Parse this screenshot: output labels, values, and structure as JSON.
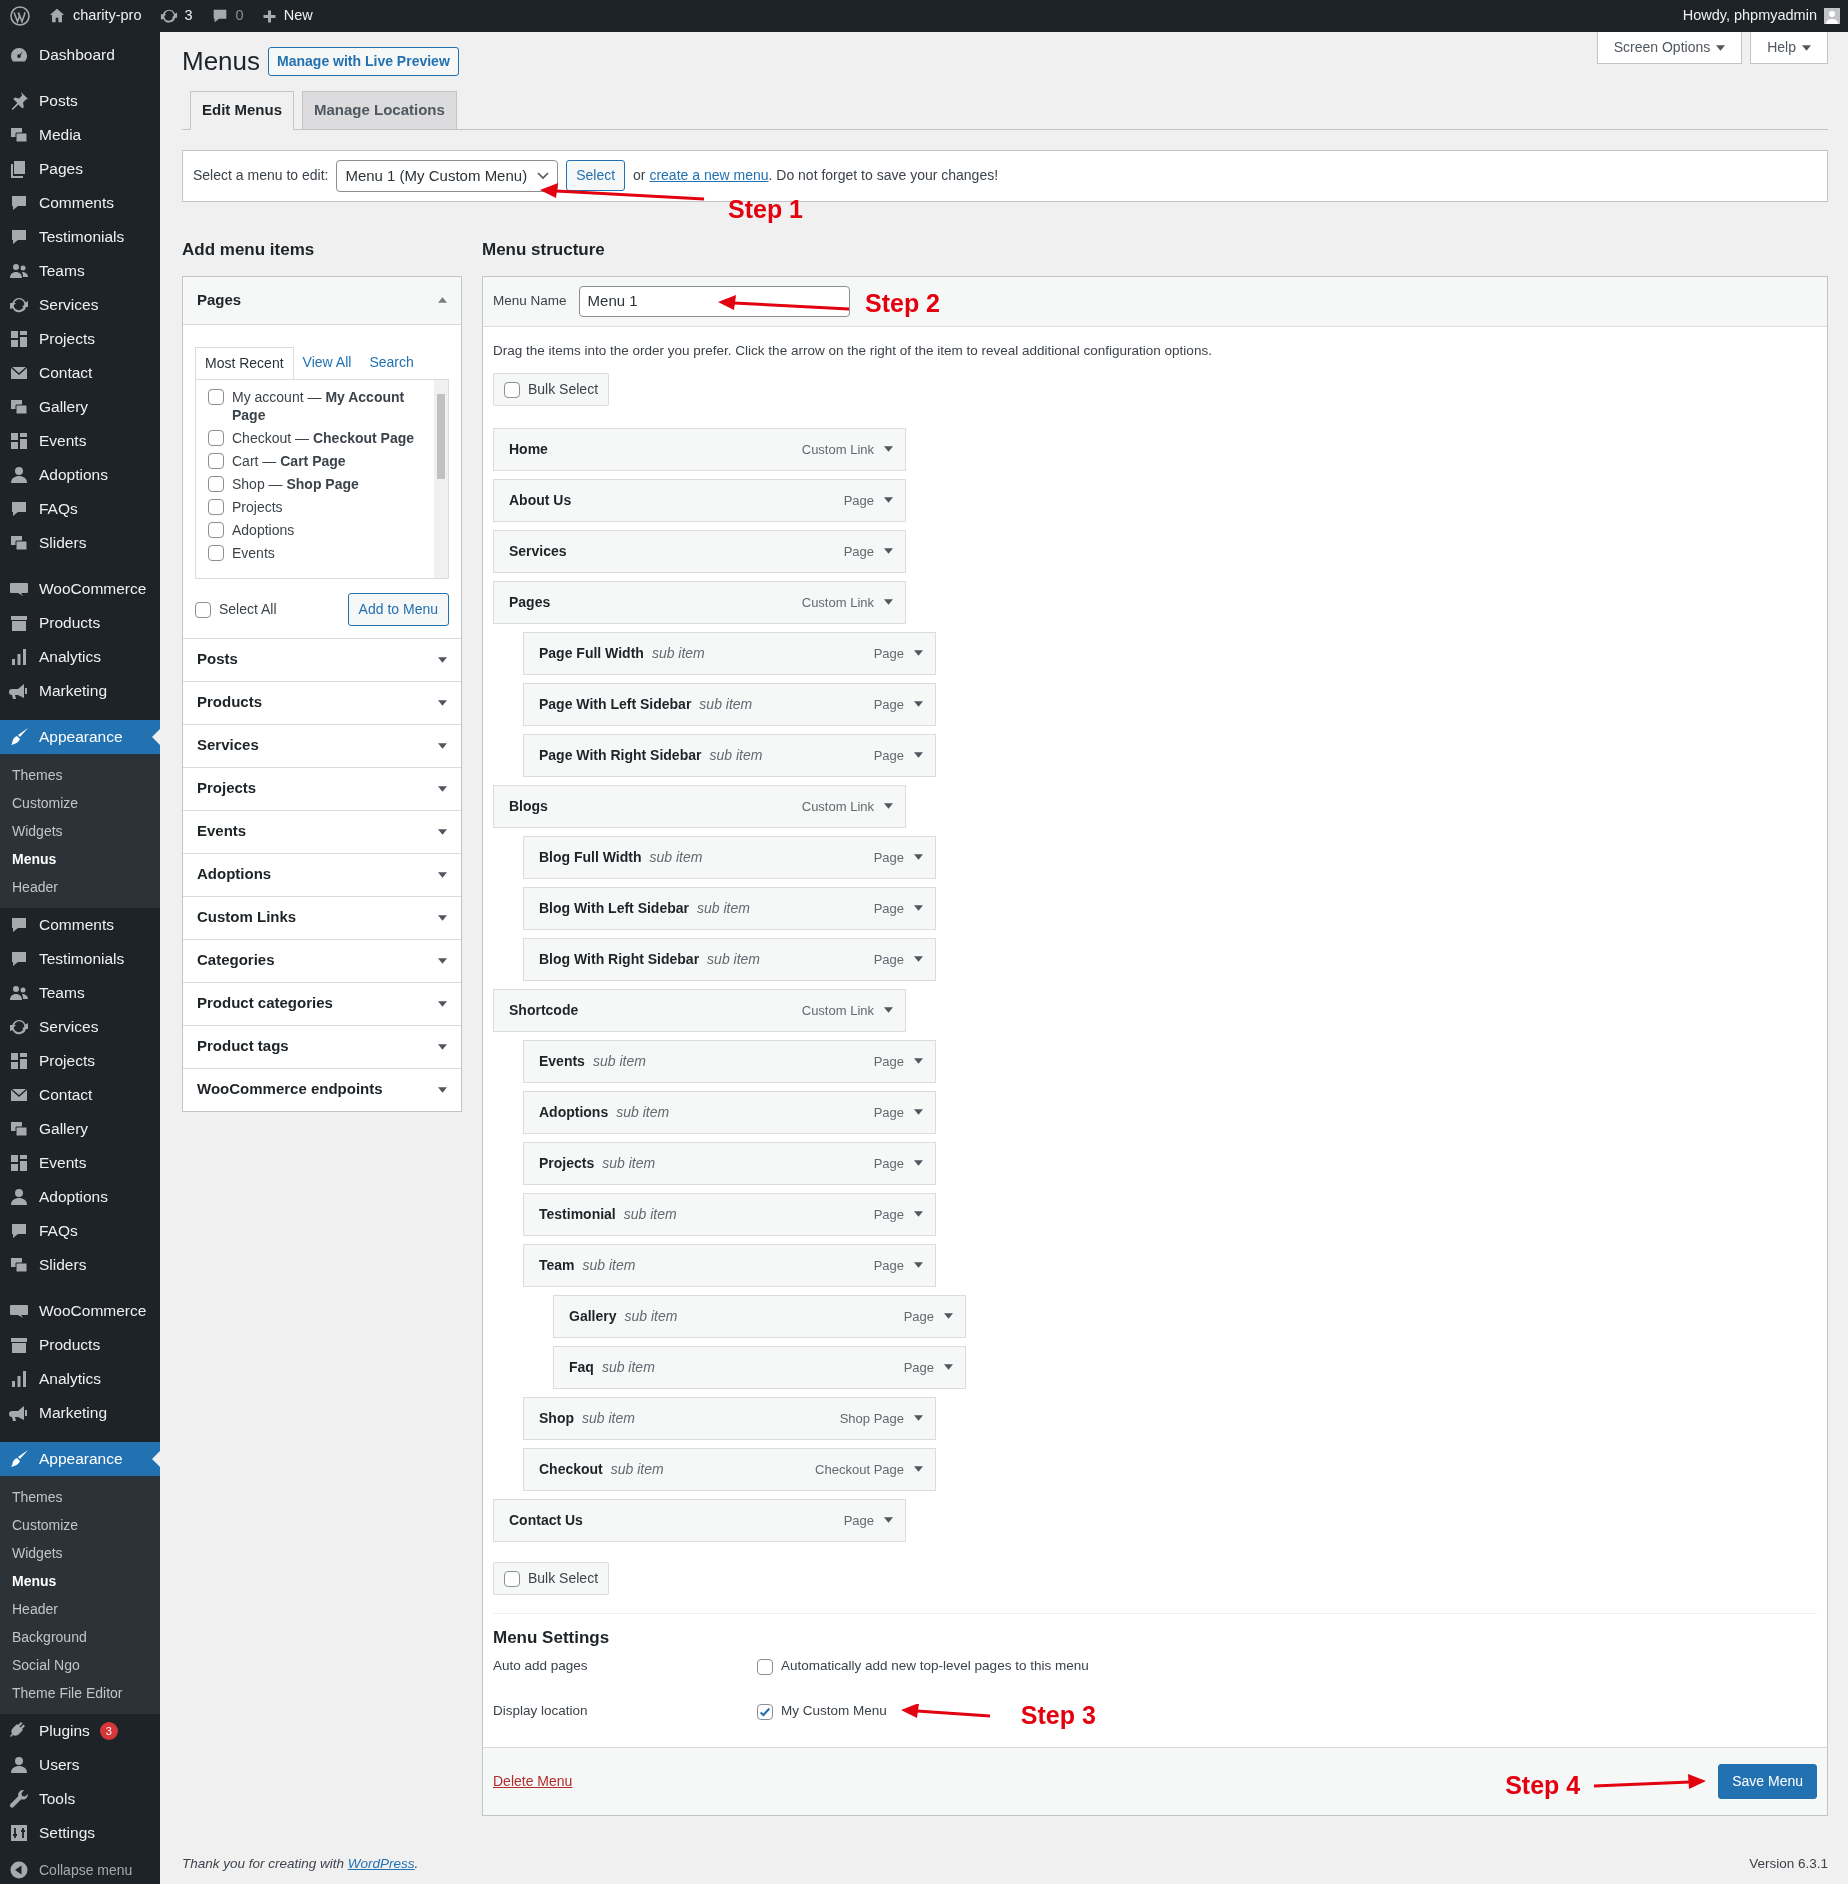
{
  "admin_bar": {
    "site": "charity-pro",
    "updates": "3",
    "comments": "0",
    "new": "New",
    "greeting": "Howdy, phpmyadmin"
  },
  "sidebar": {
    "groups": [
      [
        {
          "label": "Dashboard",
          "selected": false
        }
      ],
      [
        {
          "label": "Posts",
          "selected": false
        },
        {
          "label": "Media",
          "selected": false
        },
        {
          "label": "Pages",
          "selected": false
        },
        {
          "label": "Comments",
          "selected": false
        },
        {
          "label": "Testimonials",
          "selected": false
        },
        {
          "label": "Teams",
          "selected": false
        },
        {
          "label": "Services",
          "selected": false
        },
        {
          "label": "Projects",
          "selected": false
        },
        {
          "label": "Contact",
          "selected": false
        },
        {
          "label": "Gallery",
          "selected": false
        },
        {
          "label": "Events",
          "selected": false
        },
        {
          "label": "Adoptions",
          "selected": false
        },
        {
          "label": "FAQs",
          "selected": false
        },
        {
          "label": "Sliders",
          "selected": false
        }
      ],
      [
        {
          "label": "WooCommerce",
          "selected": false
        },
        {
          "label": "Products",
          "selected": false
        },
        {
          "label": "Analytics",
          "selected": false
        },
        {
          "label": "Marketing",
          "selected": false
        }
      ],
      [
        {
          "label": "Appearance",
          "selected": true,
          "children": [
            {
              "label": "Themes",
              "selected": false
            },
            {
              "label": "Customize",
              "selected": false
            },
            {
              "label": "Widgets",
              "selected": false
            },
            {
              "label": "Menus",
              "selected": true
            },
            {
              "label": "Header",
              "selected": false
            }
          ]
        },
        {
          "label": "Comments",
          "selected": false
        },
        {
          "label": "Testimonials",
          "selected": false
        },
        {
          "label": "Teams",
          "selected": false
        },
        {
          "label": "Services",
          "selected": false
        },
        {
          "label": "Projects",
          "selected": false
        },
        {
          "label": "Contact",
          "selected": false
        },
        {
          "label": "Gallery",
          "selected": false
        },
        {
          "label": "Events",
          "selected": false
        },
        {
          "label": "Adoptions",
          "selected": false
        },
        {
          "label": "FAQs",
          "selected": false
        },
        {
          "label": "Sliders",
          "selected": false
        }
      ],
      [
        {
          "label": "WooCommerce",
          "selected": false
        },
        {
          "label": "Products",
          "selected": false
        },
        {
          "label": "Analytics",
          "selected": false
        },
        {
          "label": "Marketing",
          "selected": false
        }
      ],
      [
        {
          "label": "Appearance",
          "selected": true,
          "children": [
            {
              "label": "Themes",
              "selected": false
            },
            {
              "label": "Customize",
              "selected": false
            },
            {
              "label": "Widgets",
              "selected": false
            },
            {
              "label": "Menus",
              "selected": true
            },
            {
              "label": "Header",
              "selected": false
            },
            {
              "label": "Background",
              "selected": false
            },
            {
              "label": "Social Ngo",
              "selected": false
            },
            {
              "label": "Theme File Editor",
              "selected": false
            }
          ]
        },
        {
          "label": "Plugins",
          "selected": false,
          "badge": "3"
        },
        {
          "label": "Users",
          "selected": false
        },
        {
          "label": "Tools",
          "selected": false
        },
        {
          "label": "Settings",
          "selected": false
        }
      ]
    ],
    "collapse": "Collapse menu"
  },
  "screen_options": "Screen Options",
  "help": "Help",
  "page": {
    "title": "Menus",
    "live_preview": "Manage with Live Preview"
  },
  "tabs": [
    {
      "label": "Edit Menus",
      "selected": true
    },
    {
      "label": "Manage Locations",
      "selected": false
    }
  ],
  "menu_select": {
    "label": "Select a menu to edit:",
    "value": "Menu 1 (My Custom Menu)",
    "button": "Select",
    "note_before": "or ",
    "link": "create a new menu",
    "note_after": ". Do not forget to save your changes!"
  },
  "annotations": [
    {
      "text": "Step 1"
    },
    {
      "text": "Step 2"
    },
    {
      "text": "Step 3"
    },
    {
      "text": "Step 4"
    }
  ],
  "add_items": {
    "heading": "Add menu items",
    "sections": [
      {
        "title": "Pages",
        "expanded": true,
        "tabs": [
          {
            "label": "Most Recent",
            "selected": true
          },
          {
            "label": "View All",
            "selected": false
          },
          {
            "label": "Search",
            "selected": false
          }
        ],
        "items": [
          {
            "label": "My account — **My Account Page**",
            "checked": false
          },
          {
            "label": "Checkout — **Checkout Page**",
            "checked": false
          },
          {
            "label": "Cart — **Cart Page**",
            "checked": false
          },
          {
            "label": "Shop — **Shop Page**",
            "checked": false
          },
          {
            "label": "Projects",
            "checked": false
          },
          {
            "label": "Adoptions",
            "checked": false
          },
          {
            "label": "Events",
            "checked": false
          }
        ],
        "select_all": {
          "label": "Select All",
          "checked": false
        },
        "button": "Add to Menu"
      },
      {
        "title": "Posts",
        "expanded": false
      },
      {
        "title": "Products",
        "expanded": false
      },
      {
        "title": "Services",
        "expanded": false
      },
      {
        "title": "Projects",
        "expanded": false
      },
      {
        "title": "Events",
        "expanded": false
      },
      {
        "title": "Adoptions",
        "expanded": false
      },
      {
        "title": "Custom Links",
        "expanded": false
      },
      {
        "title": "Categories",
        "expanded": false
      },
      {
        "title": "Product categories",
        "expanded": false
      },
      {
        "title": "Product tags",
        "expanded": false
      },
      {
        "title": "WooCommerce endpoints",
        "expanded": false
      }
    ]
  },
  "structure": {
    "heading": "Menu structure",
    "name_label": "Menu Name",
    "name_value": "Menu 1",
    "instructions": "Drag the items into the order you prefer. Click the arrow on the right of the item to reveal additional configuration options.",
    "bulk_top": {
      "label": "Bulk Select",
      "checked": false
    },
    "items": [
      {
        "title": "Home",
        "type": "Custom Link"
      },
      {
        "title": "About Us",
        "type": "Page"
      },
      {
        "title": "Services",
        "type": "Page"
      },
      {
        "title": "Pages",
        "type": "Custom Link",
        "children": [
          {
            "title": "Page Full Width",
            "note": "sub item",
            "type": "Page"
          },
          {
            "title": "Page With Left Sidebar",
            "note": "sub item",
            "type": "Page"
          },
          {
            "title": "Page With Right Sidebar",
            "note": "sub item",
            "type": "Page"
          }
        ]
      },
      {
        "title": "Blogs",
        "type": "Custom Link",
        "children": [
          {
            "title": "Blog Full Width",
            "note": "sub item",
            "type": "Page"
          },
          {
            "title": "Blog With Left Sidebar",
            "note": "sub item",
            "type": "Page"
          },
          {
            "title": "Blog With Right Sidebar",
            "note": "sub item",
            "type": "Page"
          }
        ]
      },
      {
        "title": "Shortcode",
        "type": "Custom Link",
        "children": [
          {
            "title": "Events",
            "note": "sub item",
            "type": "Page"
          },
          {
            "title": "Adoptions",
            "note": "sub item",
            "type": "Page"
          },
          {
            "title": "Projects",
            "note": "sub item",
            "type": "Page"
          },
          {
            "title": "Testimonial",
            "note": "sub item",
            "type": "Page"
          },
          {
            "title": "Team",
            "note": "sub item",
            "type": "Page",
            "children": [
              {
                "title": "Gallery",
                "note": "sub item",
                "type": "Page"
              },
              {
                "title": "Faq",
                "note": "sub item",
                "type": "Page"
              }
            ]
          },
          {
            "title": "Shop",
            "note": "sub item",
            "type": "Shop Page"
          },
          {
            "title": "Checkout",
            "note": "sub item",
            "type": "Checkout Page"
          }
        ]
      },
      {
        "title": "Contact Us",
        "type": "Page"
      }
    ],
    "bulk_bottom": {
      "label": "Bulk Select",
      "checked": false
    },
    "settings": {
      "heading": "Menu Settings",
      "rows": [
        {
          "label": "Auto add pages",
          "option": "Automatically add new top-level pages to this menu",
          "checked": false
        },
        {
          "label": "Display location",
          "option": "My Custom Menu",
          "checked": true
        }
      ]
    },
    "delete": "Delete Menu",
    "save": "Save Menu"
  },
  "footer": {
    "thanks_before": "Thank you for creating with ",
    "link": "WordPress",
    "thanks_after": ".",
    "version": "Version 6.3.1"
  }
}
